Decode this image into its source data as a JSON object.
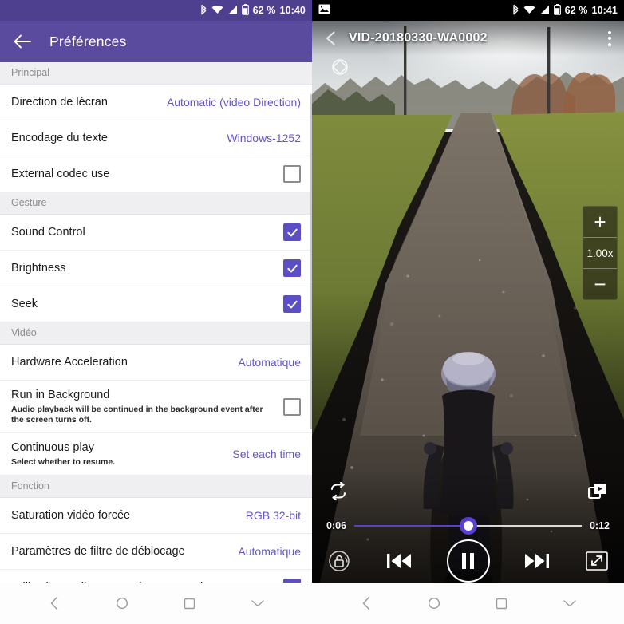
{
  "left": {
    "statusbar": {
      "bluetooth_icon": "bluetooth-icon",
      "wifi_icon": "wifi-icon",
      "signal_icon": "signal-icon",
      "battery_icon": "battery-icon",
      "battery_text": "62 %",
      "time": "10:40"
    },
    "appbar": {
      "back_icon": "back-arrow-icon",
      "title": "Préférences"
    },
    "sections": [
      {
        "header": "Principal",
        "rows": [
          {
            "title": "Direction de lécran",
            "value": "Automatic (video Direction)",
            "control": "value"
          },
          {
            "title": "Encodage du texte",
            "value": "Windows-1252",
            "control": "value"
          },
          {
            "title": "External codec use",
            "control": "checkbox",
            "checked": false
          }
        ]
      },
      {
        "header": "Gesture",
        "rows": [
          {
            "title": "Sound Control",
            "control": "checkbox",
            "checked": true
          },
          {
            "title": "Brightness",
            "control": "checkbox",
            "checked": true
          },
          {
            "title": "Seek",
            "control": "checkbox",
            "checked": true
          }
        ]
      },
      {
        "header": "Vidéo",
        "rows": [
          {
            "title": "Hardware Acceleration",
            "value": "Automatique",
            "control": "value"
          },
          {
            "title": "Run in Background",
            "subtitle": "Audio playback will be continued in the background event after the screen turns off.",
            "control": "checkbox",
            "checked": false
          },
          {
            "title": "Continuous play",
            "subtitle": "Select whether to resume.",
            "value": "Set each time",
            "control": "value"
          }
        ]
      },
      {
        "header": "Fonction",
        "rows": [
          {
            "title": "Saturation vidéo forcée",
            "value": "RGB 32-bit",
            "control": "value"
          },
          {
            "title": "Paramètres de filtre de déblocage",
            "value": "Automatique",
            "control": "value"
          },
          {
            "title": "Utilisation audio pour prolongement de temps",
            "control": "checkbox",
            "checked": true
          }
        ]
      }
    ],
    "navbar": {
      "back_icon": "nav-back-icon",
      "home_icon": "nav-home-icon",
      "recents_icon": "nav-recents-icon",
      "collapse_icon": "nav-collapse-icon"
    }
  },
  "right": {
    "statusbar": {
      "screenshot_icon": "screenshot-icon",
      "bluetooth_icon": "bluetooth-icon",
      "wifi_icon": "wifi-icon",
      "signal_icon": "signal-icon",
      "battery_icon": "battery-icon",
      "battery_text": "62 %",
      "time": "10:41"
    },
    "player": {
      "back_icon": "back-arrow-icon",
      "title": "VID-20180330-WA0002",
      "overflow_icon": "overflow-menu-icon",
      "rotation_lock_icon": "rotation-lock-icon",
      "speed": {
        "increase_icon": "plus-icon",
        "value": "1.00x",
        "decrease_icon": "minus-icon"
      },
      "loop_icon": "loop-icon",
      "popup_icon": "picture-in-picture-icon",
      "lock_icon": "screen-lock-icon",
      "previous_icon": "skip-previous-icon",
      "pause_icon": "pause-icon",
      "next_icon": "skip-next-icon",
      "fullscreen_icon": "fullscreen-icon",
      "current_time": "0:06",
      "total_time": "0:12",
      "progress_percent": 50,
      "accent_color": "#5b3fd0"
    },
    "navbar": {
      "back_icon": "nav-back-icon",
      "home_icon": "nav-home-icon",
      "recents_icon": "nav-recents-icon",
      "collapse_icon": "nav-collapse-icon"
    }
  },
  "theme": {
    "appbar_color": "#5b4b9e",
    "statusbar_color": "#4e3f8f",
    "accent_value_color": "#6256c8",
    "checkbox_on_color": "#5c4fc6"
  }
}
